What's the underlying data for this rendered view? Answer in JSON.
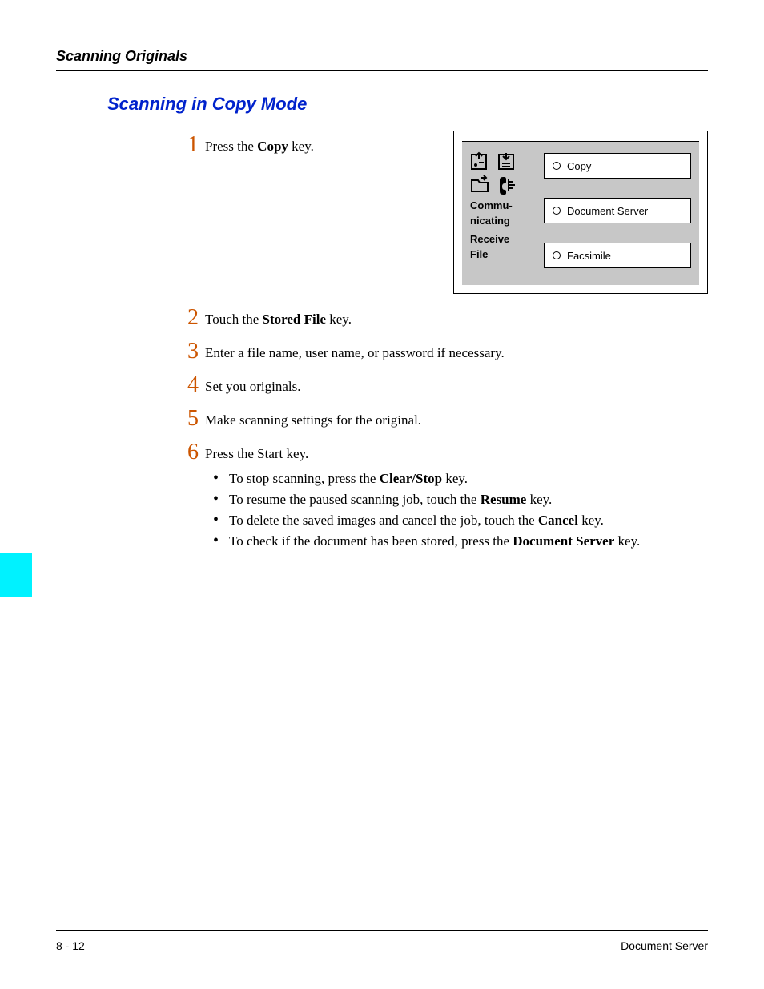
{
  "header": {
    "running": "Scanning Originals"
  },
  "section_title": "Scanning in Copy Mode",
  "steps": {
    "s1": {
      "num": "1",
      "pre": "Press the ",
      "bold": "Copy",
      "post": " key."
    },
    "s2": {
      "num": "2",
      "pre": "Touch the ",
      "bold": "Stored File",
      "post": " key."
    },
    "s3": {
      "num": "3",
      "text": "Enter a file name, user name, or password if necessary."
    },
    "s4": {
      "num": "4",
      "text": "Set you originals."
    },
    "s5": {
      "num": "5",
      "text": "Make scanning settings for the original."
    },
    "s6": {
      "num": "6",
      "text": "Press the Start key."
    }
  },
  "bullets": {
    "b1": {
      "pre": "To stop scanning, press the ",
      "bold": "Clear/Stop",
      "post": " key."
    },
    "b2": {
      "pre": "To resume the paused scanning job, touch the ",
      "bold": "Resume",
      "post": " key."
    },
    "b3": {
      "pre": "To delete the saved images and cancel the job, touch the ",
      "bold": "Cancel",
      "post": " key."
    },
    "b4": {
      "pre": "To check if the document has been stored, press the ",
      "bold": "Document Server",
      "post": " key."
    }
  },
  "figure": {
    "left": {
      "line1": "Commu-",
      "line2": "nicating",
      "line3": "Receive",
      "line4": "File"
    },
    "buttons": {
      "copy": "Copy",
      "docserver": "Document Server",
      "fax": "Facsimile"
    }
  },
  "footer": {
    "left": "8 - 12",
    "right": "Document Server"
  }
}
